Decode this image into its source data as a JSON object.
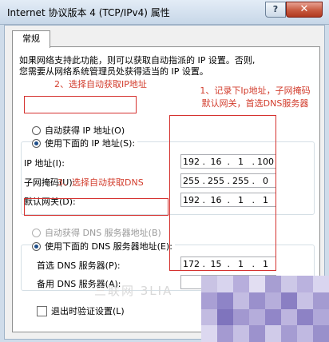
{
  "window": {
    "title": "Internet 协议版本 4 (TCP/IPv4) 属性",
    "help_label": "?",
    "close_label": "✕"
  },
  "tab": {
    "label": "常规"
  },
  "description": {
    "line1": "如果网络支持此功能，则可以获取自动指派的 IP 设置。否则,",
    "line2": "您需要从网络系统管理员处获得适当的 IP 设置。"
  },
  "ip_section": {
    "auto_label": "自动获得 IP 地址(O)",
    "manual_label": "使用下面的 IP 地址(S):",
    "ip_label": "IP 地址(I):",
    "mask_label": "子网掩码(U):",
    "gateway_label": "默认网关(D):",
    "ip": [
      "192",
      "16",
      "1",
      "100"
    ],
    "mask": [
      "255",
      "255",
      "255",
      "0"
    ],
    "gateway": [
      "192",
      "16",
      "1",
      "1"
    ]
  },
  "dns_section": {
    "auto_label": "自动获得 DNS 服务器地址(B)",
    "manual_label": "使用下面的 DNS 服务器地址(E):",
    "preferred_label": "首选 DNS 服务器(P):",
    "alternate_label": "备用 DNS 服务器(A):",
    "preferred": [
      "172",
      "15",
      "1",
      "1"
    ],
    "alternate": [
      "",
      "",
      "",
      ""
    ]
  },
  "validate": {
    "label": "退出时验证设置(L)"
  },
  "annotations": {
    "a1_line1": "1、记录下Ip地址，子网掩码",
    "a1_line2": "默认网关，首选DNS服务器",
    "a2": "2、选择自动获取IP地址",
    "a3": "3、选择自动获取DNS"
  },
  "watermark": "三联网 3LIA",
  "colors": {
    "annotation_red": "#d23c2c",
    "window_frame": "#cfdcea",
    "close_red": "#c85a40"
  }
}
